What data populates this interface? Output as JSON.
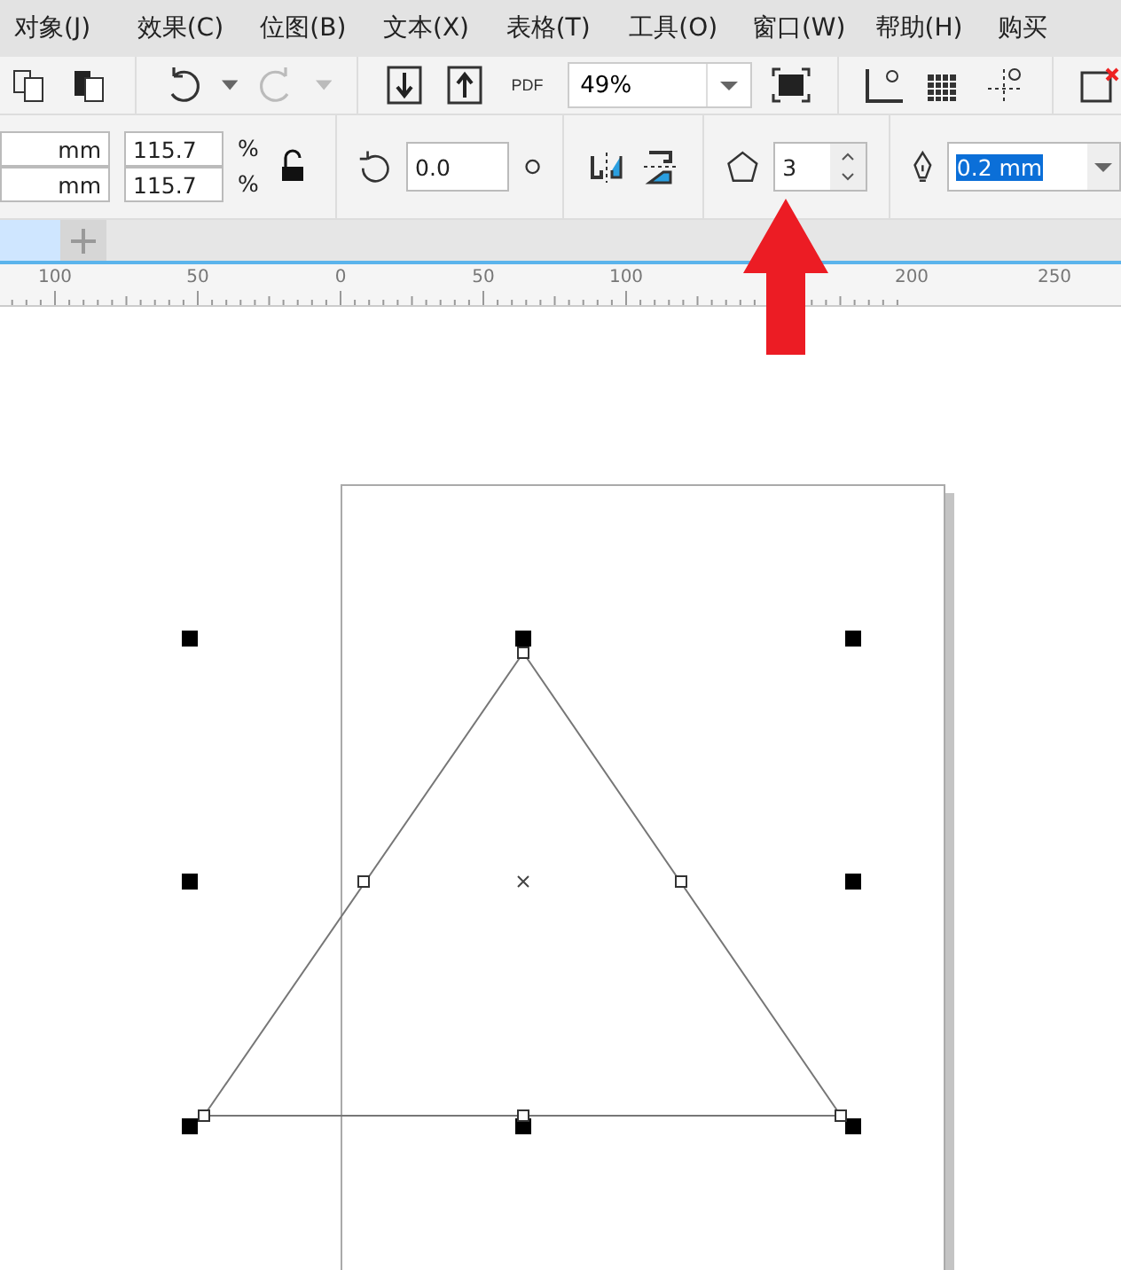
{
  "menu": [
    {
      "label": "对象(J)"
    },
    {
      "label": "效果(C)"
    },
    {
      "label": "位图(B)"
    },
    {
      "label": "文本(X)"
    },
    {
      "label": "表格(T)"
    },
    {
      "label": "工具(O)"
    },
    {
      "label": "窗口(W)"
    },
    {
      "label": "帮助(H)"
    },
    {
      "label": "购买"
    }
  ],
  "toolbar": {
    "pdf_label": "PDF",
    "zoom": "49%"
  },
  "properties": {
    "size_units": [
      "mm",
      "mm"
    ],
    "scale": [
      "115.7",
      "115.7"
    ],
    "scale_unit": "%",
    "locked": false,
    "rotation": "0.0",
    "sides": "3",
    "outline": {
      "value": "0.2 mm",
      "selected": true
    }
  },
  "ruler": [
    {
      "label": "100"
    },
    {
      "label": "50"
    },
    {
      "label": "0"
    },
    {
      "label": "50"
    },
    {
      "label": "100"
    },
    {
      "label": "200"
    },
    {
      "label": "250"
    }
  ]
}
